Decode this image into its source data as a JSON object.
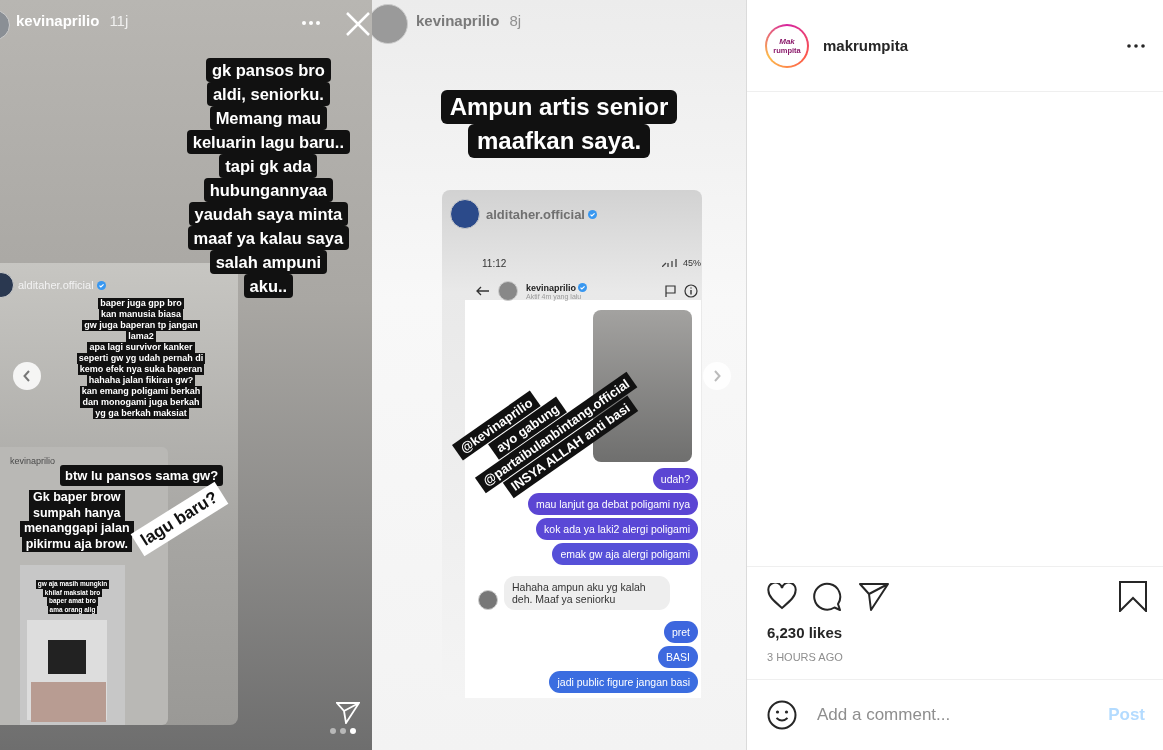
{
  "story_left": {
    "username": "kevinaprilio",
    "time": "11j",
    "caption_lines": [
      "gk pansos bro",
      "aldi, seniorku.",
      "Memang mau",
      "keluarin lagu baru..",
      "tapi gk ada",
      "hubungannyaa",
      "yaudah saya minta",
      "maaf ya kalau saya",
      "salah   ampuni",
      "aku.."
    ],
    "reply_card": {
      "username": "alditaher.official",
      "lines": [
        "baper juga gpp bro",
        "kan manusia biasa",
        "gw juga baperan tp jangan",
        "lama2",
        "apa lagi survivor kanker",
        "seperti gw yg udah pernah di",
        "kemo efek nya suka baperan",
        "hahaha jalan fikiran gw?",
        "kan emang poligami berkah",
        "dan monogami juga berkah",
        "yg ga berkah maksiat"
      ],
      "inner_card": {
        "username": "kevinaprilio",
        "question": "btw lu pansos sama gw?",
        "answer_lines": [
          "Gk baper brow",
          "sumpah   hanya",
          "menanggapi jalan",
          "pikirmu aja brow."
        ],
        "tag": "lagu baru?",
        "nested_card": {
          "lines": [
            "gw aja masih mungkin",
            "khilaf maksiat bro",
            "baper amat bro",
            "ama orang alig"
          ]
        }
      }
    }
  },
  "story_right": {
    "username": "kevinaprilio",
    "time": "8j",
    "caption_lines": [
      "Ampun artis senior",
      "maafkan saya."
    ],
    "shared_card": {
      "username": "alditaher.official",
      "status_time": "11:12",
      "battery": "45%",
      "chat_user": "kevinaprilio",
      "chat_status": "Aktif 4m yang lalu",
      "stickers": [
        "@kevinaprilio",
        "ayo gabung",
        "@partaibulanbintang.official",
        "INSYA ALLAH anti basi"
      ],
      "messages": [
        {
          "kind": "sent",
          "text": "udah?",
          "color": "#5b45d3"
        },
        {
          "kind": "sent",
          "text": "mau lanjut ga debat poligami nya",
          "color": "#5b45d3"
        },
        {
          "kind": "sent",
          "text": "kok ada ya laki2 alergi poligami",
          "color": "#5a48d6"
        },
        {
          "kind": "sent",
          "text": "emak gw aja alergi poligami",
          "color": "#5650d8"
        },
        {
          "kind": "received",
          "text": "Hahaha ampun   aku yg kalah deh. Maaf ya seniorku",
          "color": "#eeeeee"
        },
        {
          "kind": "sent",
          "text": "pret",
          "color": "#3d66de"
        },
        {
          "kind": "sent",
          "text": "BASI",
          "color": "#3d69df"
        },
        {
          "kind": "sent",
          "text": "jadi public figure jangan basi",
          "color": "#3b6de0"
        }
      ]
    }
  },
  "sidebar": {
    "logo_lines": [
      "Mak",
      "rumpita"
    ],
    "account": "makrumpita",
    "likes": "6,230 likes",
    "time": "3 HOURS AGO",
    "comment": {
      "placeholder": "Add a comment..."
    },
    "post_button": "Post"
  }
}
